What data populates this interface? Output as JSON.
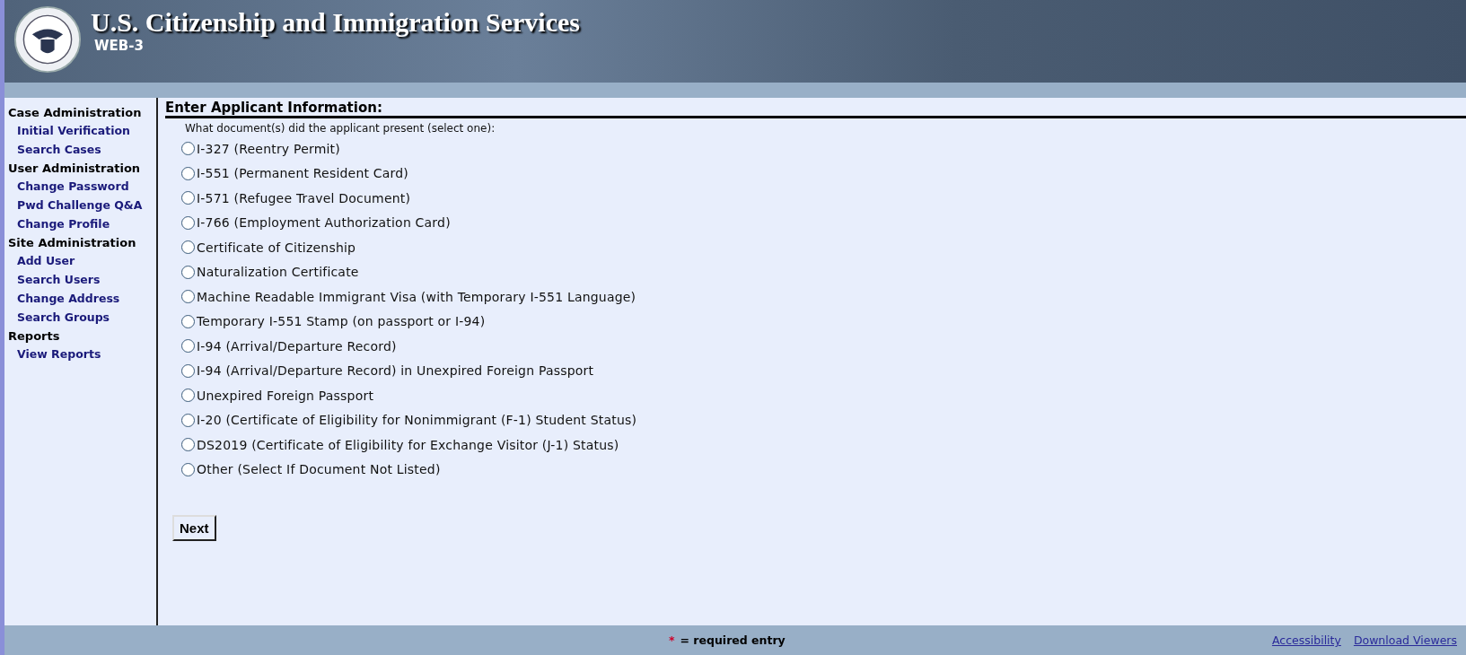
{
  "header": {
    "title": "U.S. Citizenship and Immigration Services",
    "subtitle": "WEB-3"
  },
  "sidebar": {
    "sections": [
      {
        "heading": "Case Administration",
        "items": [
          "Initial Verification",
          "Search Cases"
        ]
      },
      {
        "heading": "User Administration",
        "items": [
          "Change Password",
          "Pwd Challenge Q&A",
          "Change Profile"
        ]
      },
      {
        "heading": "Site Administration",
        "items": [
          "Add User",
          "Search Users",
          "Change Address",
          "Search Groups"
        ]
      },
      {
        "heading": "Reports",
        "items": [
          "View Reports"
        ]
      }
    ]
  },
  "form": {
    "title": "Enter Applicant Information:",
    "question": "What document(s) did the applicant present (select one):",
    "options": [
      {
        "label": "I-327 (Reentry Permit)",
        "selected": false
      },
      {
        "label": "I-551 (Permanent Resident Card)",
        "selected": false
      },
      {
        "label": "I-571 (Refugee Travel Document)",
        "selected": false
      },
      {
        "label": "I-766 (Employment Authorization Card)",
        "selected": false
      },
      {
        "label": "Certificate of Citizenship",
        "selected": false
      },
      {
        "label": "Naturalization Certificate",
        "selected": false
      },
      {
        "label": "Machine Readable Immigrant Visa (with Temporary I-551 Language)",
        "selected": false
      },
      {
        "label": "Temporary I-551 Stamp (on passport or I-94)",
        "selected": false
      },
      {
        "label": "I-94 (Arrival/Departure Record)",
        "selected": false
      },
      {
        "label": "I-94 (Arrival/Departure Record) in Unexpired Foreign Passport",
        "selected": false
      },
      {
        "label": "Unexpired Foreign Passport",
        "selected": false
      },
      {
        "label": "I-20 (Certificate of Eligibility for Nonimmigrant (F-1) Student Status)",
        "selected": false
      },
      {
        "label": "DS2019 (Certificate of Eligibility for Exchange Visitor (J-1) Status)",
        "selected": false
      },
      {
        "label": "Other (Select If Document Not Listed)",
        "selected": false
      }
    ],
    "button": "Next"
  },
  "footer": {
    "required_mark": "*",
    "required_text": "= required entry",
    "links": [
      "Accessibility",
      "Download Viewers"
    ]
  }
}
